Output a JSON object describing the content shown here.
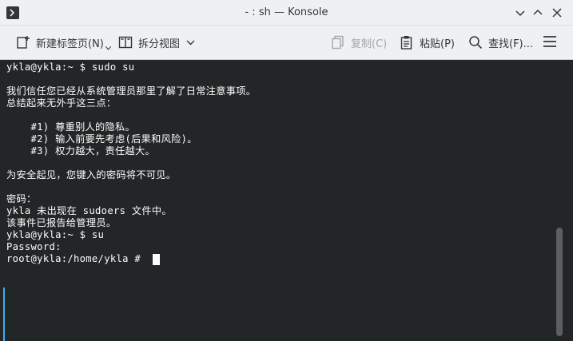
{
  "window": {
    "title": "- : sh — Konsole"
  },
  "toolbar": {
    "new_tab": "新建标签页(N)",
    "split_view": "拆分视图",
    "copy": "复制(C)",
    "paste": "粘贴(P)",
    "find": "查找(F)..."
  },
  "terminal": {
    "lines": [
      "ykla@ykla:~ $ sudo su",
      "",
      "我们信任您已经从系统管理员那里了解了日常注意事项。",
      "总结起来无外乎这三点：",
      "",
      "    #1) 尊重别人的隐私。",
      "    #2) 输入前要先考虑(后果和风险)。",
      "    #3) 权力越大，责任越大。",
      "",
      "为安全起见，您键入的密码将不可见。",
      "",
      "密码：",
      "ykla 未出现在 sudoers 文件中。",
      "该事件已报告给管理员。",
      "ykla@ykla:~ $ su",
      "Password:",
      "root@ykla:/home/ykla # "
    ]
  },
  "colors": {
    "terminal_bg": "#232627",
    "terminal_fg": "#fcfcfc",
    "chrome_bg": "#eff0f1",
    "accent": "#3daee9"
  }
}
